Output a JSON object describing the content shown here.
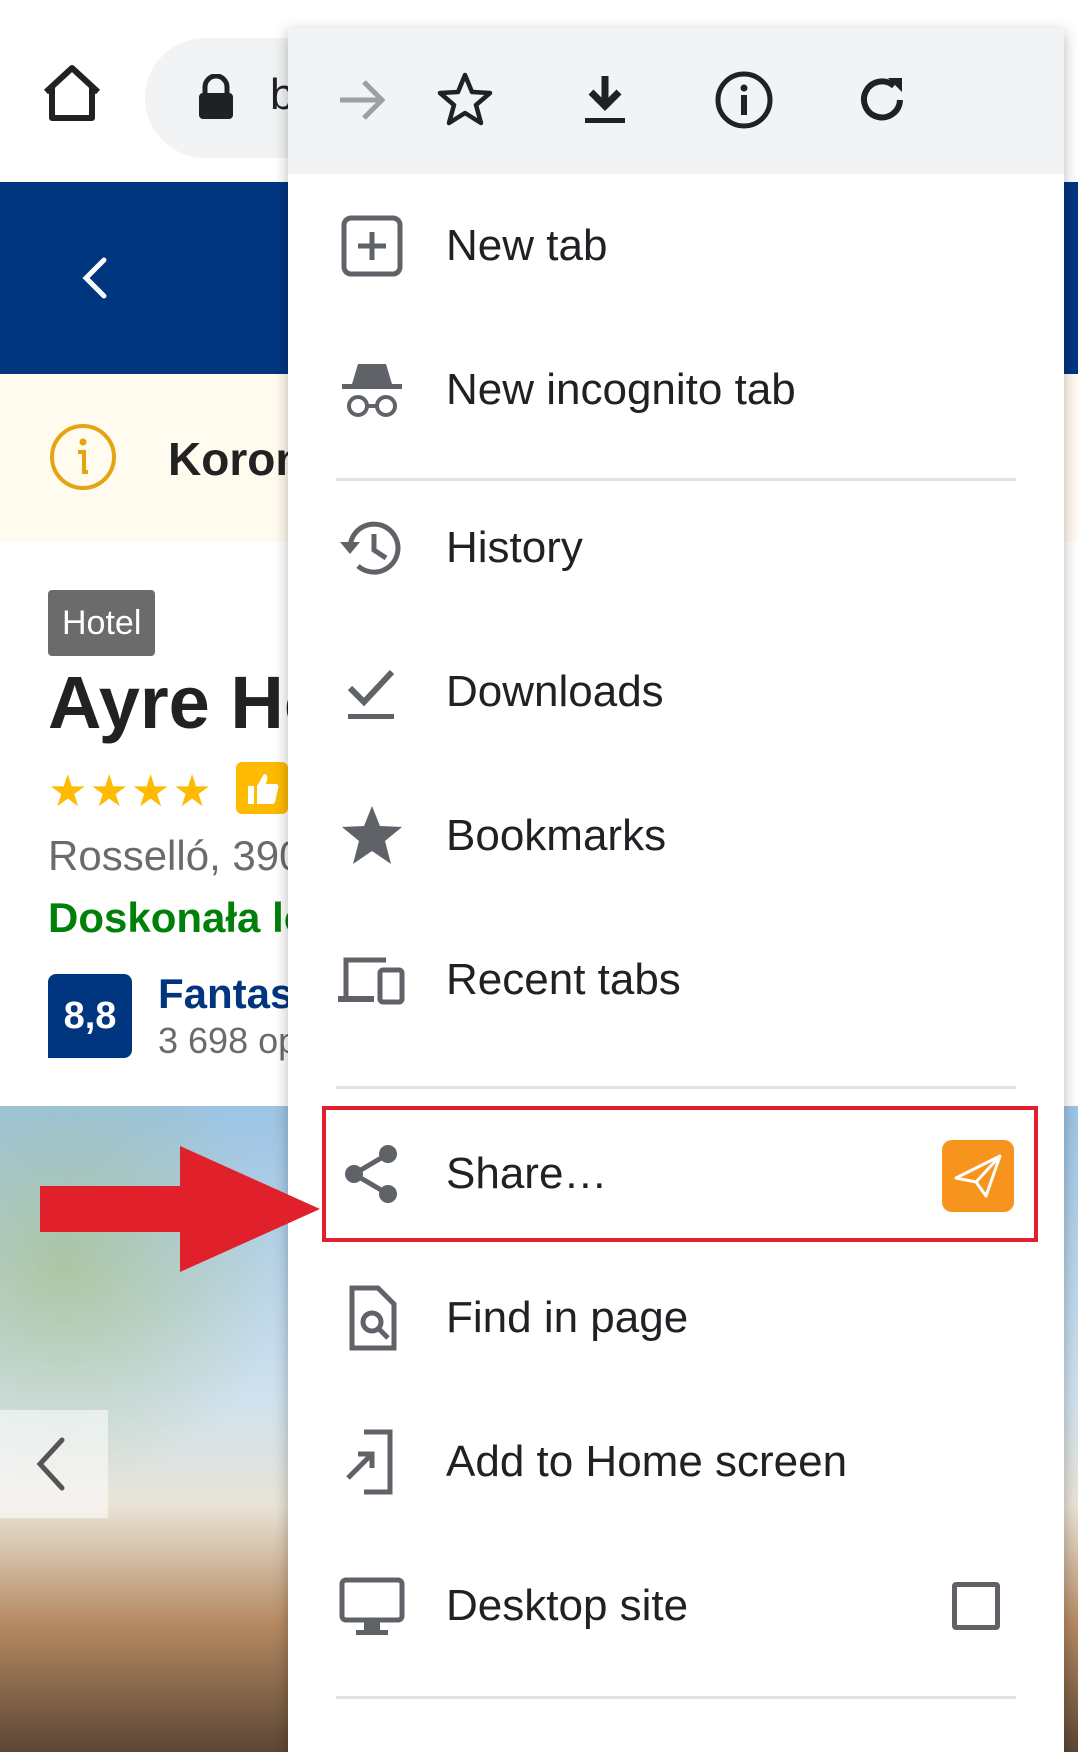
{
  "page": {
    "url_fragment": "b",
    "notice_text": "Koron",
    "property_type": "Hotel",
    "hotel_name": "Ayre Ho",
    "stars": "★★★★",
    "address": "Rosselló, 390",
    "location_label": "Doskonała lo",
    "score": "8,8",
    "score_label": "Fantast",
    "reviews": "3 698 op"
  },
  "menu": {
    "top_icons": [
      "forward-arrow-icon",
      "star-outline-icon",
      "download-icon",
      "info-icon",
      "refresh-icon"
    ],
    "items": [
      {
        "label": "New tab",
        "icon": "new-tab-icon"
      },
      {
        "label": "New incognito tab",
        "icon": "incognito-icon"
      },
      {
        "label": "History",
        "icon": "history-icon"
      },
      {
        "label": "Downloads",
        "icon": "downloads-check-icon"
      },
      {
        "label": "Bookmarks",
        "icon": "bookmark-star-icon"
      },
      {
        "label": "Recent tabs",
        "icon": "recent-tabs-devices-icon"
      },
      {
        "label": "Share…",
        "icon": "share-icon"
      },
      {
        "label": "Find in page",
        "icon": "find-in-page-icon"
      },
      {
        "label": "Add to Home screen",
        "icon": "add-to-home-icon"
      },
      {
        "label": "Desktop site",
        "icon": "desktop-icon"
      }
    ],
    "desktop_site_checked": false
  },
  "colors": {
    "brand_blue": "#003580",
    "highlight_red": "#e0202a",
    "share_badge_orange": "#f7941d",
    "star_yellow": "#febb02",
    "location_green": "#008009"
  }
}
